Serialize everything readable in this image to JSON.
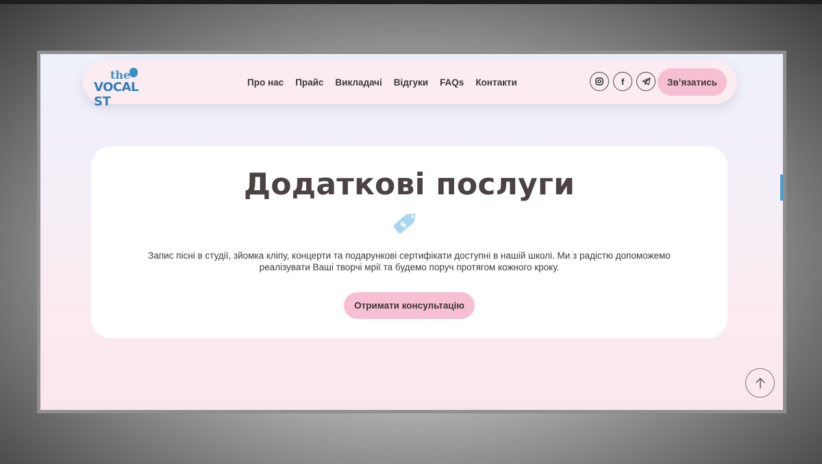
{
  "brand": {
    "logo_top": "the",
    "logo_bottom": "VOCAL ST",
    "accent_color": "#3a8fc4",
    "button_color": "#f7bfd3"
  },
  "nav": {
    "items": [
      "Про нас",
      "Прайс",
      "Викладачі",
      "Відгуки",
      "FAQs",
      "Контакти"
    ]
  },
  "socials": [
    {
      "icon": "instagram-icon"
    },
    {
      "icon": "facebook-icon",
      "glyph": "f"
    },
    {
      "icon": "telegram-icon"
    }
  ],
  "header": {
    "contact_label": "Зв’язатись"
  },
  "hero": {
    "title": "Додаткові послуги",
    "icon": "price-tag-icon",
    "description_line1": "Запис пісні в студії, зйомка кліпу, концерти та подарункові сертифікати доступні в нашій школі. Ми з радістю допоможемо",
    "description_line2": "реалізувати Ваші творчі мрії та будемо поруч протягом кожного кроку.",
    "cta_label": "Отримати консультацію"
  },
  "scroll_top": {
    "icon": "arrow-up-icon"
  }
}
